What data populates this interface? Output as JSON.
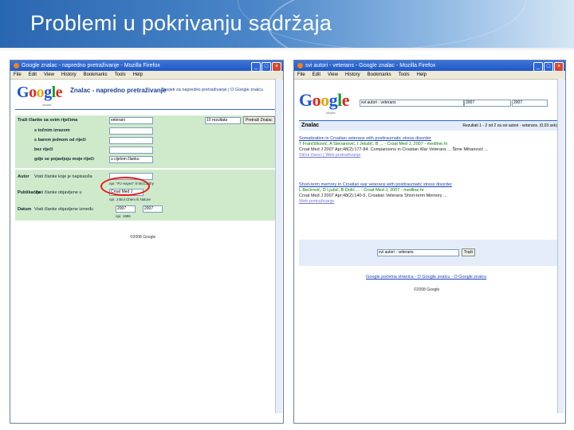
{
  "slide": {
    "title": "Problemi u pokrivanju sadržaja"
  },
  "left_window": {
    "title": "Google znalac - napredno pretraživanje - Mozilla Firefox",
    "menu": [
      "File",
      "Edit",
      "View",
      "History",
      "Bookmarks",
      "Tools",
      "Help"
    ],
    "logo_sub": "znalac",
    "page_title": "Znalac - napredno pretraživanje",
    "links": "Savjeti za napredno pretraživanje | O Google znalcu",
    "rows": {
      "all_words": "Traži članke sa svim riječima",
      "exact_phrase": "s točnim izrazom",
      "at_least_one": "s barem jednom od riječi",
      "without": "bez riječi",
      "where": "gdje se pojavljuju moje riječi",
      "author": "Autor",
      "author_hint": "Vrati članke koje je napisao/la",
      "author_example": "npr. \"PJ Hayes\" ili McCarthy",
      "publication": "Publikacija",
      "publication_hint": "Vrati članke objavljene u",
      "publication_example": "npr. J Biol Chem ili Nature",
      "date": "Datum",
      "date_hint": "Vrati članke objavljene između",
      "date_example": "npr. 1996"
    },
    "values": {
      "all_words": "veterani",
      "where": "u cijelom članku",
      "publication": "Croat Med J",
      "year_from": "2007",
      "year_to": "2007",
      "results": "10 rezultata",
      "search_btn": "Pretraži Znalac"
    },
    "copyright": "©2008 Google"
  },
  "right_window": {
    "title": "svi autori - veterans - Google znalac - Mozilla Firefox",
    "menu": [
      "File",
      "Edit",
      "View",
      "History",
      "Bookmarks",
      "Tools",
      "Help"
    ],
    "logo_sub": "znalac",
    "search_query": "svi autori - veterans",
    "year_from": "2007",
    "year_to": "2007",
    "bar_label": "Znalac",
    "stats": "Rezultati 1 - 2 od 2 za svi autori - veterans. (0,03 sek)",
    "results": [
      {
        "title": "Somatization in Croatian veterans with posttraumatic stress disorder",
        "authors": "T Frančišković, A Stevanović, I Jelušić, B ... - Croat Med J, 2007 - medline.hr",
        "snippet": "Croat Med J 2007 Apr;48(2):177-84. Comparisons in Croatian War Veterans ... Šime Mihanović ...",
        "links": "Slični članci | Web pretraživanje"
      },
      {
        "title": "Short-term memory in Croatian war veterans with posttraumatic stress disorder",
        "authors": "L Bećirović, D Ljubić, B Dolić ... - Croat Med J, 2007 - medline.hr",
        "snippet": "Croat Med J 2007 Apr;48(2):140-5. Croatian Veterans Short-term Memory ...",
        "links": "Web pretraživanje"
      }
    ],
    "bottom_query": "svi autori - veterans",
    "bottom_btn": "Traži",
    "footer_links": "Google početna stranica - O Google znalcu - O Google znalcu",
    "copyright": "©2008 Google"
  },
  "colors": {
    "header": "#2a67b1",
    "panel_green": "#cfeacb",
    "result_bar": "#e5ecf9",
    "circle": "#e81818"
  }
}
